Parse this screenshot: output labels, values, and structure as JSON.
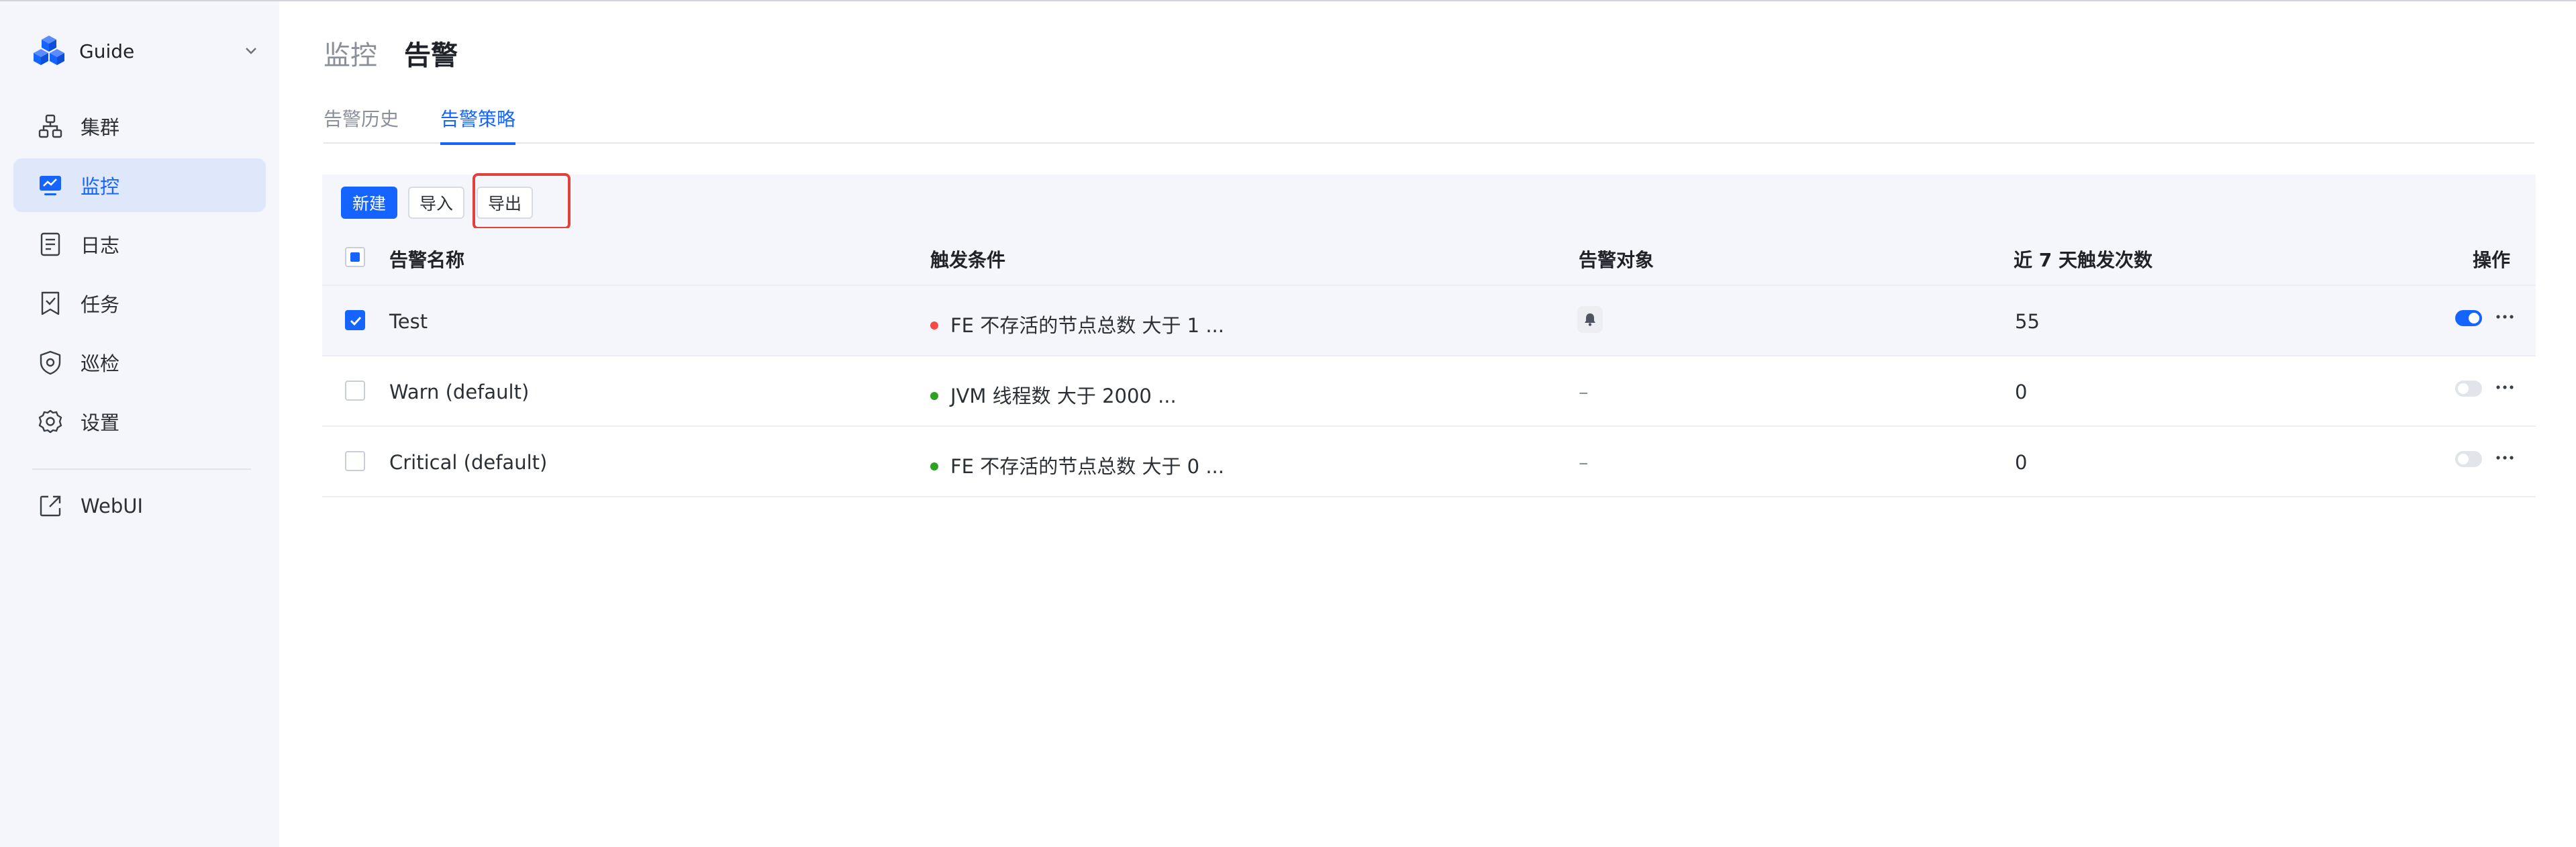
{
  "sidebar": {
    "brand": "Guide",
    "items": [
      {
        "label": "集群",
        "icon": "cluster-icon"
      },
      {
        "label": "监控",
        "icon": "monitor-icon",
        "active": true
      },
      {
        "label": "日志",
        "icon": "log-icon"
      },
      {
        "label": "任务",
        "icon": "task-icon"
      },
      {
        "label": "巡检",
        "icon": "inspect-shield-icon"
      },
      {
        "label": "设置",
        "icon": "gear-icon"
      }
    ],
    "external": {
      "label": "WebUI",
      "icon": "external-link-icon"
    }
  },
  "header": {
    "parent": "监控",
    "current": "告警"
  },
  "tabs": [
    {
      "label": "告警历史",
      "active": false
    },
    {
      "label": "告警策略",
      "active": true
    }
  ],
  "toolbar": {
    "new_label": "新建",
    "import_label": "导入",
    "export_label": "导出"
  },
  "table": {
    "columns": [
      "告警名称",
      "触发条件",
      "告警对象",
      "近 7 天触发次数",
      "操作"
    ],
    "rows": [
      {
        "name": "Test",
        "condition": "FE 不存活的节点总数 大于 1 ...",
        "status_color": "#f54a45",
        "target": "bell-icon",
        "count": "55",
        "enabled": true,
        "selected": true
      },
      {
        "name": "Warn (default)",
        "condition": "JVM 线程数 大于 2000 ...",
        "status_color": "#2ea121",
        "target": "–",
        "count": "0",
        "enabled": false,
        "selected": false
      },
      {
        "name": "Critical (default)",
        "condition": "FE 不存活的节点总数 大于 0 ...",
        "status_color": "#2ea121",
        "target": "–",
        "count": "0",
        "enabled": false,
        "selected": false
      }
    ]
  },
  "colors": {
    "accent": "#1664ff",
    "highlight": "#e0413a",
    "sidebar_bg": "#f4f6fb"
  }
}
